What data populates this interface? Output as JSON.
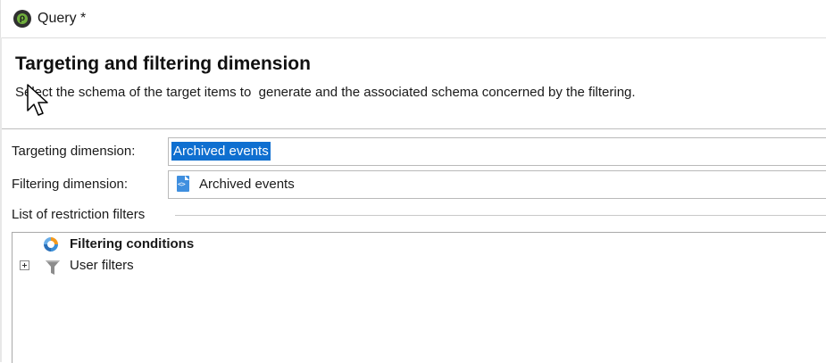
{
  "window": {
    "title": "Query *",
    "icon": "app-logo-icon"
  },
  "header": {
    "title": "Targeting and filtering dimension",
    "description": "Select the schema of the target items to  generate and the associated schema concerned by the filtering."
  },
  "form": {
    "targeting_label": "Targeting dimension:",
    "targeting_value": "Archived events",
    "filtering_label": "Filtering dimension:",
    "filtering_value": "Archived events",
    "filtering_icon": "schema-icon"
  },
  "restriction": {
    "group_label": "List of restriction filters",
    "items": [
      {
        "label": "Filtering conditions",
        "icon": "filtering-conditions-icon",
        "bold": true,
        "expandable": false
      },
      {
        "label": "User filters",
        "icon": "funnel-icon",
        "bold": false,
        "expandable": true
      }
    ]
  },
  "colors": {
    "selection": "#0f6fd0",
    "border": "#b9b9b9",
    "accent_green": "#6fae3c"
  }
}
